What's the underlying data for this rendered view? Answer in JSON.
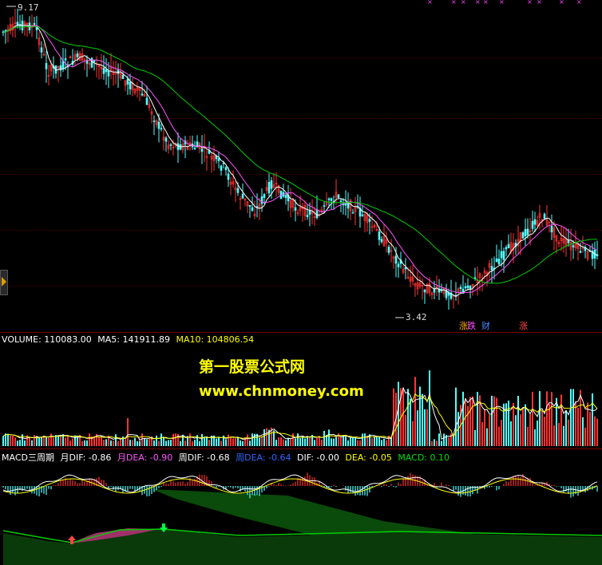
{
  "price": {
    "high_label": "9.17",
    "low_label": "3.42",
    "tags": [
      {
        "text": "涨",
        "color": "#ffaa00"
      },
      {
        "text": "跌",
        "color": "#ff55ff"
      },
      {
        "text": "财",
        "color": "#4488ff"
      },
      {
        "text": "涨",
        "color": "#ff4444"
      }
    ]
  },
  "volume": {
    "legend": [
      {
        "text": "VOLUME: 110083.00",
        "color": "#ffffff"
      },
      {
        "text": "MA5: 141911.89",
        "color": "#ffffff"
      },
      {
        "text": "MA10: 104806.54",
        "color": "#ffff00"
      }
    ]
  },
  "macd": {
    "legend": [
      {
        "text": "MACD三周期",
        "color": "#ffffff"
      },
      {
        "text": "月DIF: -0.86",
        "color": "#ffffff"
      },
      {
        "text": "月DEA: -0.90",
        "color": "#ff55ff"
      },
      {
        "text": "周DIF: -0.68",
        "color": "#ffffff"
      },
      {
        "text": "周DEA: -0.64",
        "color": "#3366ff"
      },
      {
        "text": "DIF: -0.00",
        "color": "#ffffff"
      },
      {
        "text": "DEA: -0.05",
        "color": "#ffff00"
      },
      {
        "text": "MACD: 0.10",
        "color": "#00dd00"
      }
    ]
  },
  "watermark": {
    "line1": "第一股票公式网",
    "line2": "www.chnmoney.com"
  },
  "colors": {
    "up": "#ff3333",
    "down": "#55ffff",
    "ma_short": "#ffffff",
    "ma_mid": "#ff55ff",
    "ma_long": "#00cc00",
    "macd_line": "#ffff00"
  }
}
